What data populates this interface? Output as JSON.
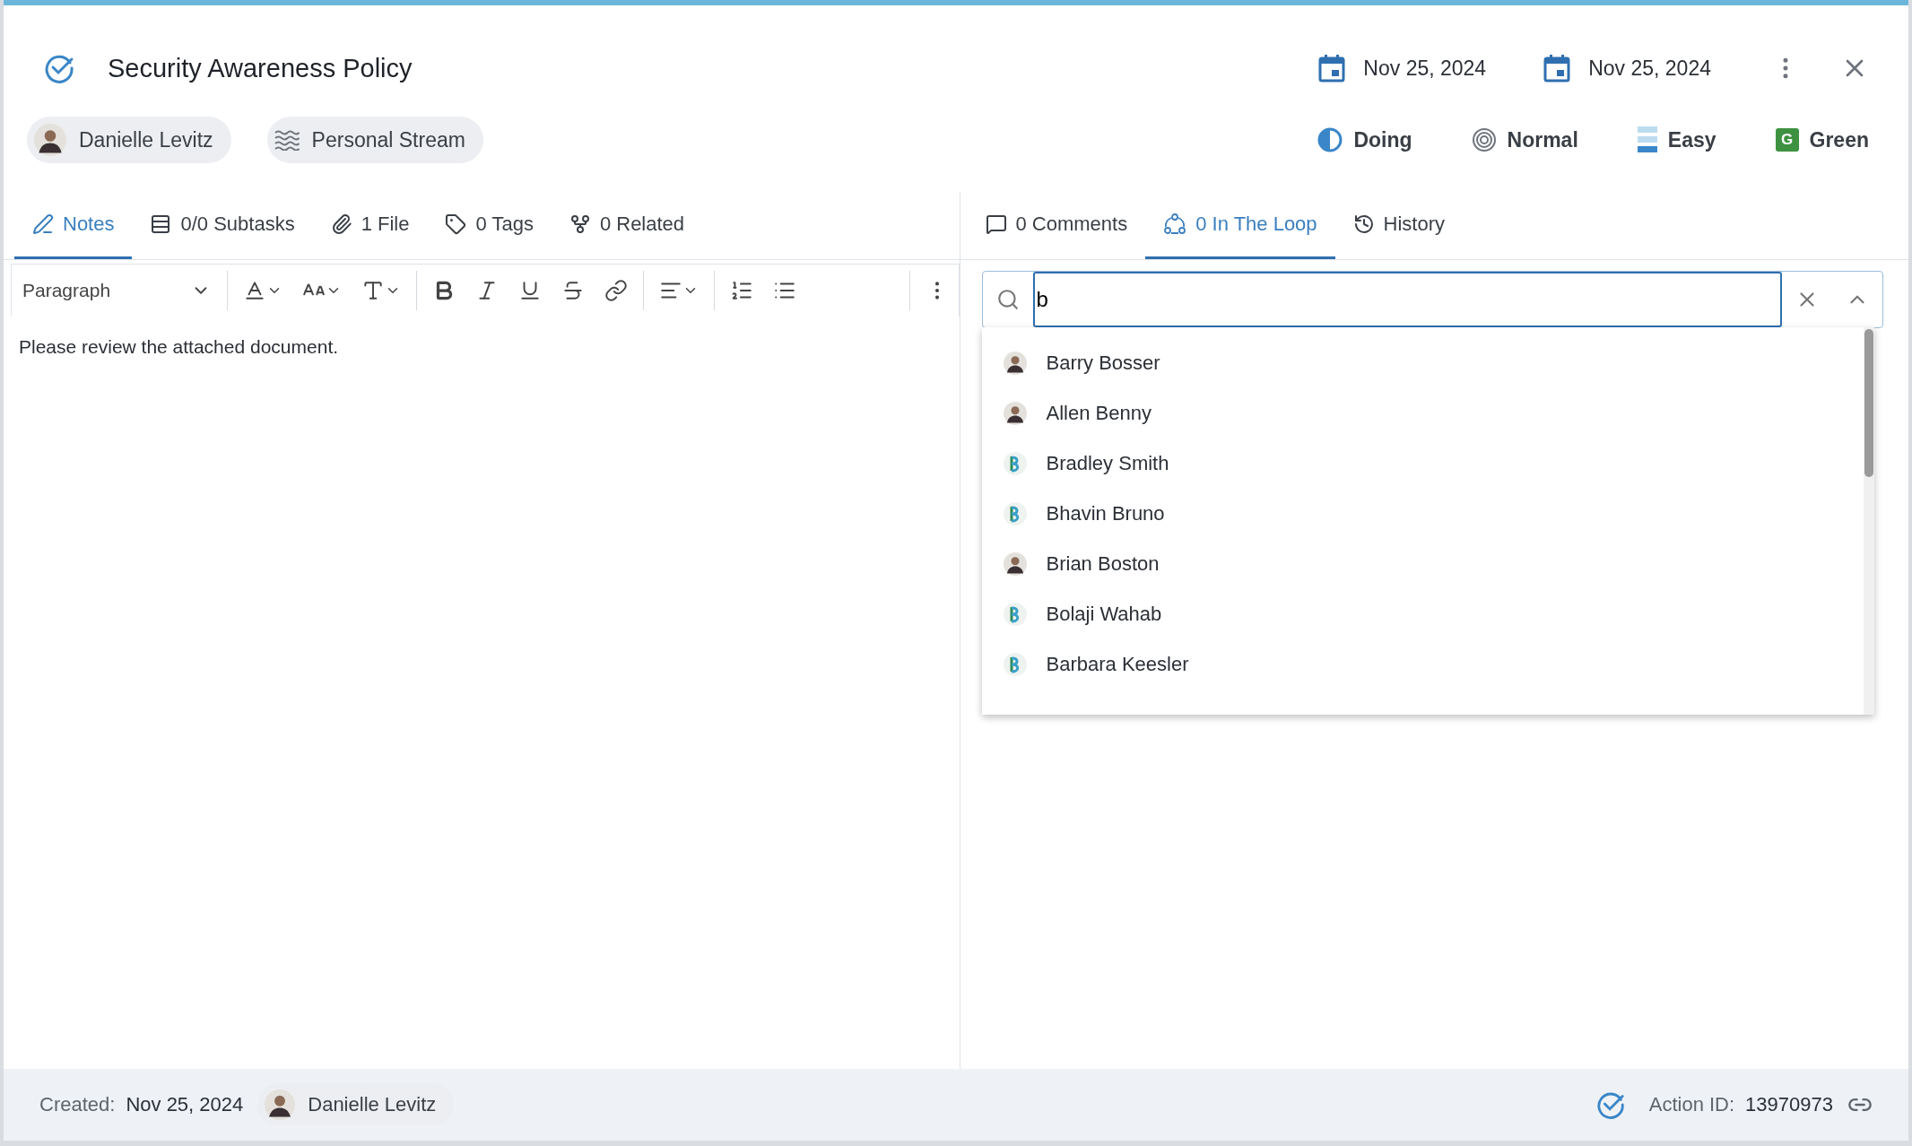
{
  "header": {
    "title": "Security Awareness Policy",
    "dates": [
      "Nov 25, 2024",
      "Nov 25, 2024"
    ]
  },
  "chips": [
    {
      "kind": "person",
      "label": "Danielle Levitz"
    },
    {
      "kind": "stream",
      "label": "Personal Stream"
    }
  ],
  "attributes": [
    {
      "kind": "status",
      "label": "Doing"
    },
    {
      "kind": "priority",
      "label": "Normal"
    },
    {
      "kind": "difficulty",
      "label": "Easy"
    },
    {
      "kind": "color",
      "label": "Green",
      "badge": "G",
      "color": "#3d9140"
    }
  ],
  "left_tabs": [
    {
      "kind": "notes",
      "label": "Notes",
      "selected": true
    },
    {
      "kind": "subtasks",
      "label": "0/0 Subtasks",
      "selected": false
    },
    {
      "kind": "file",
      "label": "1 File",
      "selected": false
    },
    {
      "kind": "tags",
      "label": "0 Tags",
      "selected": false
    },
    {
      "kind": "related",
      "label": "0 Related",
      "selected": false
    }
  ],
  "editor": {
    "block_format": "Paragraph",
    "text": "Please review the attached document."
  },
  "right_tabs": [
    {
      "kind": "comments",
      "label": "0 Comments",
      "selected": false
    },
    {
      "kind": "loop",
      "label": "0 In The Loop",
      "selected": true
    },
    {
      "kind": "history",
      "label": "History",
      "selected": false
    }
  ],
  "people_search": {
    "value": "b",
    "results": [
      {
        "name": "Barry Bosser",
        "kind": "photo"
      },
      {
        "name": "Allen Benny",
        "kind": "photo"
      },
      {
        "name": "Bradley Smith",
        "kind": "logo"
      },
      {
        "name": "Bhavin Bruno",
        "kind": "logo"
      },
      {
        "name": "Brian Boston",
        "kind": "photo"
      },
      {
        "name": "Bolaji Wahab",
        "kind": "logo"
      },
      {
        "name": "Barbara Keesler",
        "kind": "logo"
      }
    ]
  },
  "footer": {
    "created_label": "Created:",
    "created_date": "Nov 25, 2024",
    "creator": "Danielle Levitz",
    "action_id_label": "Action ID:",
    "action_id": "13970973"
  }
}
